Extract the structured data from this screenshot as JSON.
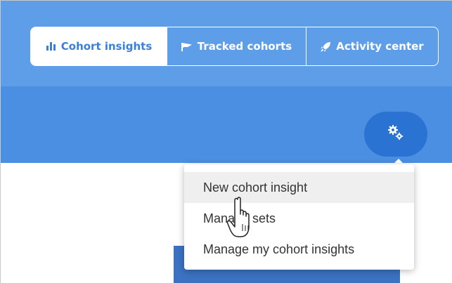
{
  "tabs": [
    {
      "label": "Cohort insights",
      "icon": "bar-chart-icon",
      "active": true
    },
    {
      "label": "Tracked cohorts",
      "icon": "flag-icon",
      "active": false
    },
    {
      "label": "Activity center",
      "icon": "rocket-icon",
      "active": false
    }
  ],
  "settings": {
    "icon": "gears-icon"
  },
  "menu": {
    "items": [
      {
        "label": "New cohort insight",
        "hovered": true
      },
      {
        "label": "Manage sets",
        "hovered": false
      },
      {
        "label": "Manage my cohort insights",
        "hovered": false
      }
    ]
  },
  "cursor": {
    "icon": "hand-pointer-icon"
  },
  "colors": {
    "header": "#5e9ee9",
    "band": "#4a8fe2",
    "accent": "#2b73d3",
    "active_tab_text": "#3b7fd6",
    "menu_hover": "#efefef",
    "menu_text": "#333333"
  }
}
